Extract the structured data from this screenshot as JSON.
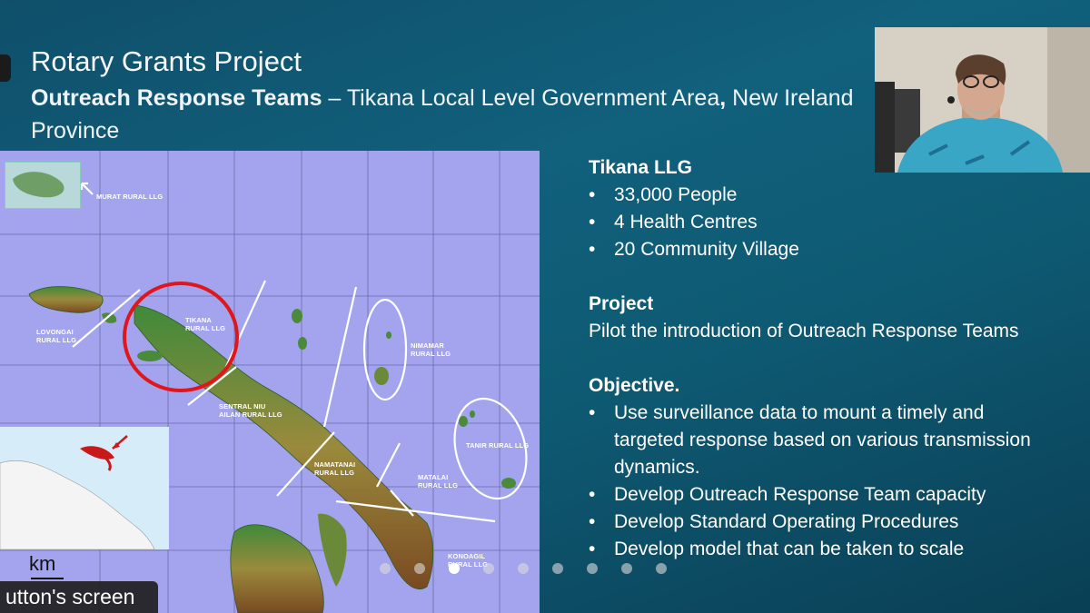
{
  "slide": {
    "title": "Rotary Grants Project",
    "subtitle_bold": "Outreach Response Teams",
    "subtitle_rest": " – Tikana Local Level Government  Area",
    "subtitle_comma": ",",
    "subtitle_tail": " New Ireland Province"
  },
  "map": {
    "labels": {
      "murat": "MURAT RURAL LLG",
      "lovongai_1": "LOVONGAI",
      "lovongai_2": "RURAL LLG",
      "tikana_1": "TIKANA",
      "tikana_2": "RURAL LLG",
      "nimamar_1": "NIMAMAR",
      "nimamar_2": "RURAL LLG",
      "sentral_1": "SENTRAL NIU",
      "sentral_2": "AILAN RURAL LLG",
      "tanir": "TANIR RURAL LLG",
      "namatanai_1": "NAMATANAI",
      "namatanai_2": "RURAL LLG",
      "matalai_1": "MATALAI",
      "matalai_2": "RURAL LLG",
      "konoagil_1": "KONOAGIL",
      "konoagil_2": "RURAL LLG"
    },
    "scale_unit": "km"
  },
  "panel": {
    "tikana_heading": "Tikana LLG",
    "tikana_items": [
      "33,000 People",
      "4 Health Centres",
      "20 Community Village"
    ],
    "project_heading": "Project",
    "project_text": "Pilot the introduction of Outreach Response Teams",
    "objective_heading": "Objective.",
    "objective_items": [
      "Use surveillance data to mount a timely and targeted  response based on various transmission dynamics.",
      "Develop Outreach Response Team capacity",
      "Develop Standard Operating Procedures",
      "Develop model that can be taken to scale"
    ]
  },
  "screenshare": {
    "label": "utton's screen"
  },
  "pagination": {
    "total": 9,
    "active": 2
  },
  "colors": {
    "ocean": "#a3a3ee",
    "highlight_circle": "#e0161b",
    "slide_bg": "#11607c"
  }
}
